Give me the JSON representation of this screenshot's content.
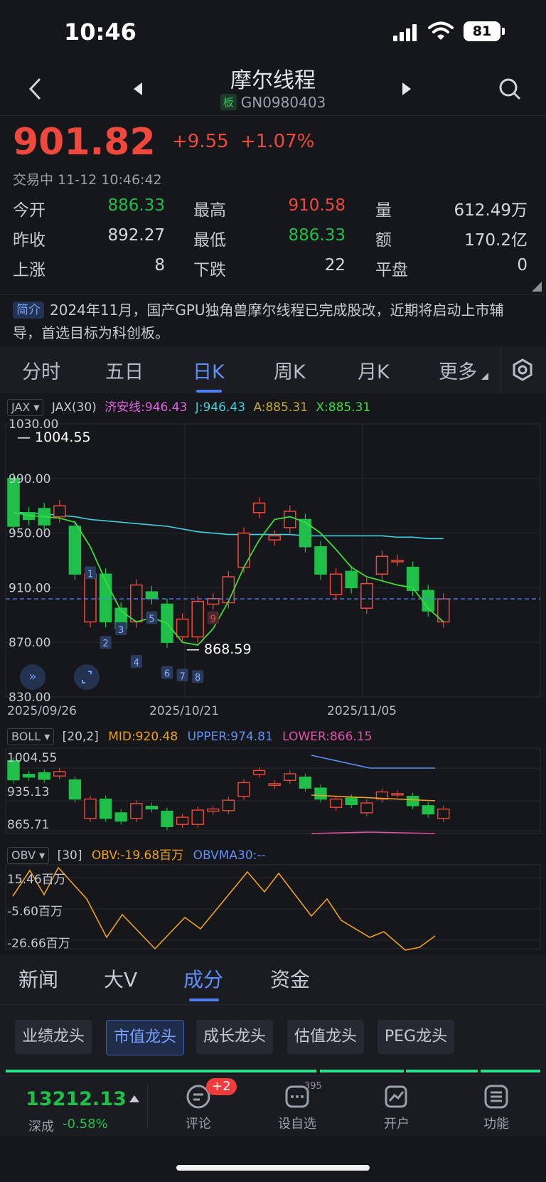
{
  "status_bar": {
    "time": "10:46",
    "battery": "81"
  },
  "header": {
    "title": "摩尔线程",
    "badge": "板",
    "code": "GN0980403"
  },
  "quote": {
    "price": "901.82",
    "change": "+9.55",
    "change_pct": "+1.07%",
    "status": "交易中 11-12 10:46:42",
    "rows": [
      [
        {
          "label": "今开",
          "value": "886.33",
          "color": "green"
        },
        {
          "label": "最高",
          "value": "910.58",
          "color": "red"
        },
        {
          "label": "量",
          "value": "612.49万",
          "color": "white"
        }
      ],
      [
        {
          "label": "昨收",
          "value": "892.27",
          "color": "white"
        },
        {
          "label": "最低",
          "value": "886.33",
          "color": "green"
        },
        {
          "label": "额",
          "value": "170.2亿",
          "color": "white"
        }
      ],
      [
        {
          "label": "上涨",
          "value": "8",
          "color": "white"
        },
        {
          "label": "下跌",
          "value": "22",
          "color": "white"
        },
        {
          "label": "平盘",
          "value": "0",
          "color": "white"
        }
      ]
    ]
  },
  "intro": {
    "tag": "简介",
    "text": "2024年11月，国产GPU独角兽摩尔线程已完成股改，近期将启动上市辅导，首选目标为科创板。"
  },
  "period_tabs": [
    "分时",
    "五日",
    "日K",
    "周K",
    "月K",
    "更多"
  ],
  "active_period": "日K",
  "main_indicator": {
    "selector": "JAX",
    "name": "JAX(30)",
    "jax": "济安线:946.43",
    "j": "J:946.43",
    "a": "A:885.31",
    "x": "X:885.31",
    "y_labels": [
      "1030.00",
      "990.00",
      "950.00",
      "910.00",
      "870.00",
      "830.00"
    ],
    "high_label": "1004.55",
    "low_label": "868.59",
    "dates": [
      "2025/09/26",
      "2025/10/21",
      "2025/11/05"
    ]
  },
  "boll_indicator": {
    "selector": "BOLL",
    "params": "[20,2]",
    "mid": "MID:920.48",
    "upper": "UPPER:974.81",
    "lower": "LOWER:866.15",
    "y_labels": [
      "1004.55",
      "935.13",
      "865.71"
    ]
  },
  "obv_indicator": {
    "selector": "OBV",
    "params": "[30]",
    "obv": "OBV:-19.68百万",
    "obvma": "OBVMA30:--",
    "y_labels": [
      "15.46百万",
      "-5.60百万",
      "-26.66百万"
    ]
  },
  "chart_data": {
    "type": "candlestick",
    "ylim": [
      830,
      1030
    ],
    "candles": [
      {
        "o": 990,
        "c": 955
      },
      {
        "o": 965,
        "c": 960
      },
      {
        "o": 968,
        "c": 956
      },
      {
        "o": 962,
        "c": 970
      },
      {
        "o": 955,
        "c": 920
      },
      {
        "o": 885,
        "c": 920
      },
      {
        "o": 920,
        "c": 885
      },
      {
        "o": 895,
        "c": 880
      },
      {
        "o": 885,
        "c": 912
      },
      {
        "o": 907,
        "c": 902
      },
      {
        "o": 898,
        "c": 870
      },
      {
        "o": 874,
        "c": 887
      },
      {
        "o": 874,
        "c": 900
      },
      {
        "o": 898,
        "c": 902
      },
      {
        "o": 899,
        "c": 918
      },
      {
        "o": 925,
        "c": 950
      },
      {
        "o": 965,
        "c": 972
      },
      {
        "o": 945,
        "c": 948
      },
      {
        "o": 954,
        "c": 966
      },
      {
        "o": 960,
        "c": 940
      },
      {
        "o": 940,
        "c": 920
      },
      {
        "o": 905,
        "c": 920
      },
      {
        "o": 922,
        "c": 910
      },
      {
        "o": 895,
        "c": 913
      },
      {
        "o": 920,
        "c": 933
      },
      {
        "o": 930,
        "c": 930
      },
      {
        "o": 925,
        "c": 908
      },
      {
        "o": 908,
        "c": 893
      },
      {
        "o": 885,
        "c": 901.82
      }
    ],
    "jax_line": [
      965,
      963,
      962,
      961,
      958,
      940,
      915,
      893,
      885,
      888,
      884,
      870,
      868,
      880,
      900,
      925,
      945,
      960,
      962,
      958,
      950,
      938,
      925,
      918,
      915,
      912,
      910,
      895,
      885
    ],
    "ma_line": [
      965,
      965,
      964,
      963,
      962,
      960,
      959,
      958,
      957,
      956,
      955,
      953,
      951,
      950,
      949,
      949,
      949,
      949,
      949,
      948,
      948,
      948,
      948,
      948,
      948,
      947,
      947,
      946,
      946
    ]
  }
}
